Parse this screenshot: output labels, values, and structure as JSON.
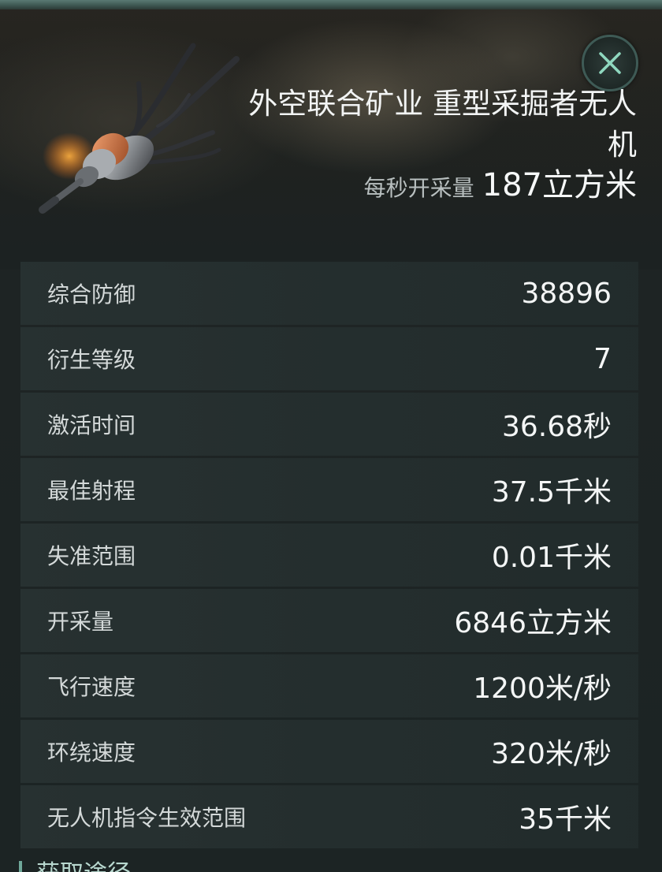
{
  "item": {
    "title": "外空联合矿业 重型采掘者无人机",
    "rate_label": "每秒开采量",
    "rate_value": "187立方米"
  },
  "close_icon": "close-icon",
  "stats": [
    {
      "label": "综合防御",
      "value": "38896"
    },
    {
      "label": "衍生等级",
      "value": "7"
    },
    {
      "label": "激活时间",
      "value": "36.68秒"
    },
    {
      "label": "最佳射程",
      "value": "37.5千米"
    },
    {
      "label": "失准范围",
      "value": "0.01千米"
    },
    {
      "label": "开采量",
      "value": "6846立方米"
    },
    {
      "label": "飞行速度",
      "value": "1200米/秒"
    },
    {
      "label": "环绕速度",
      "value": "320米/秒"
    },
    {
      "label": "无人机指令生效范围",
      "value": "35千米"
    }
  ],
  "footer": {
    "text": "获取途径"
  },
  "colors": {
    "accent": "#6fa89a",
    "row_background": "#283232",
    "background": "#1c2424"
  }
}
